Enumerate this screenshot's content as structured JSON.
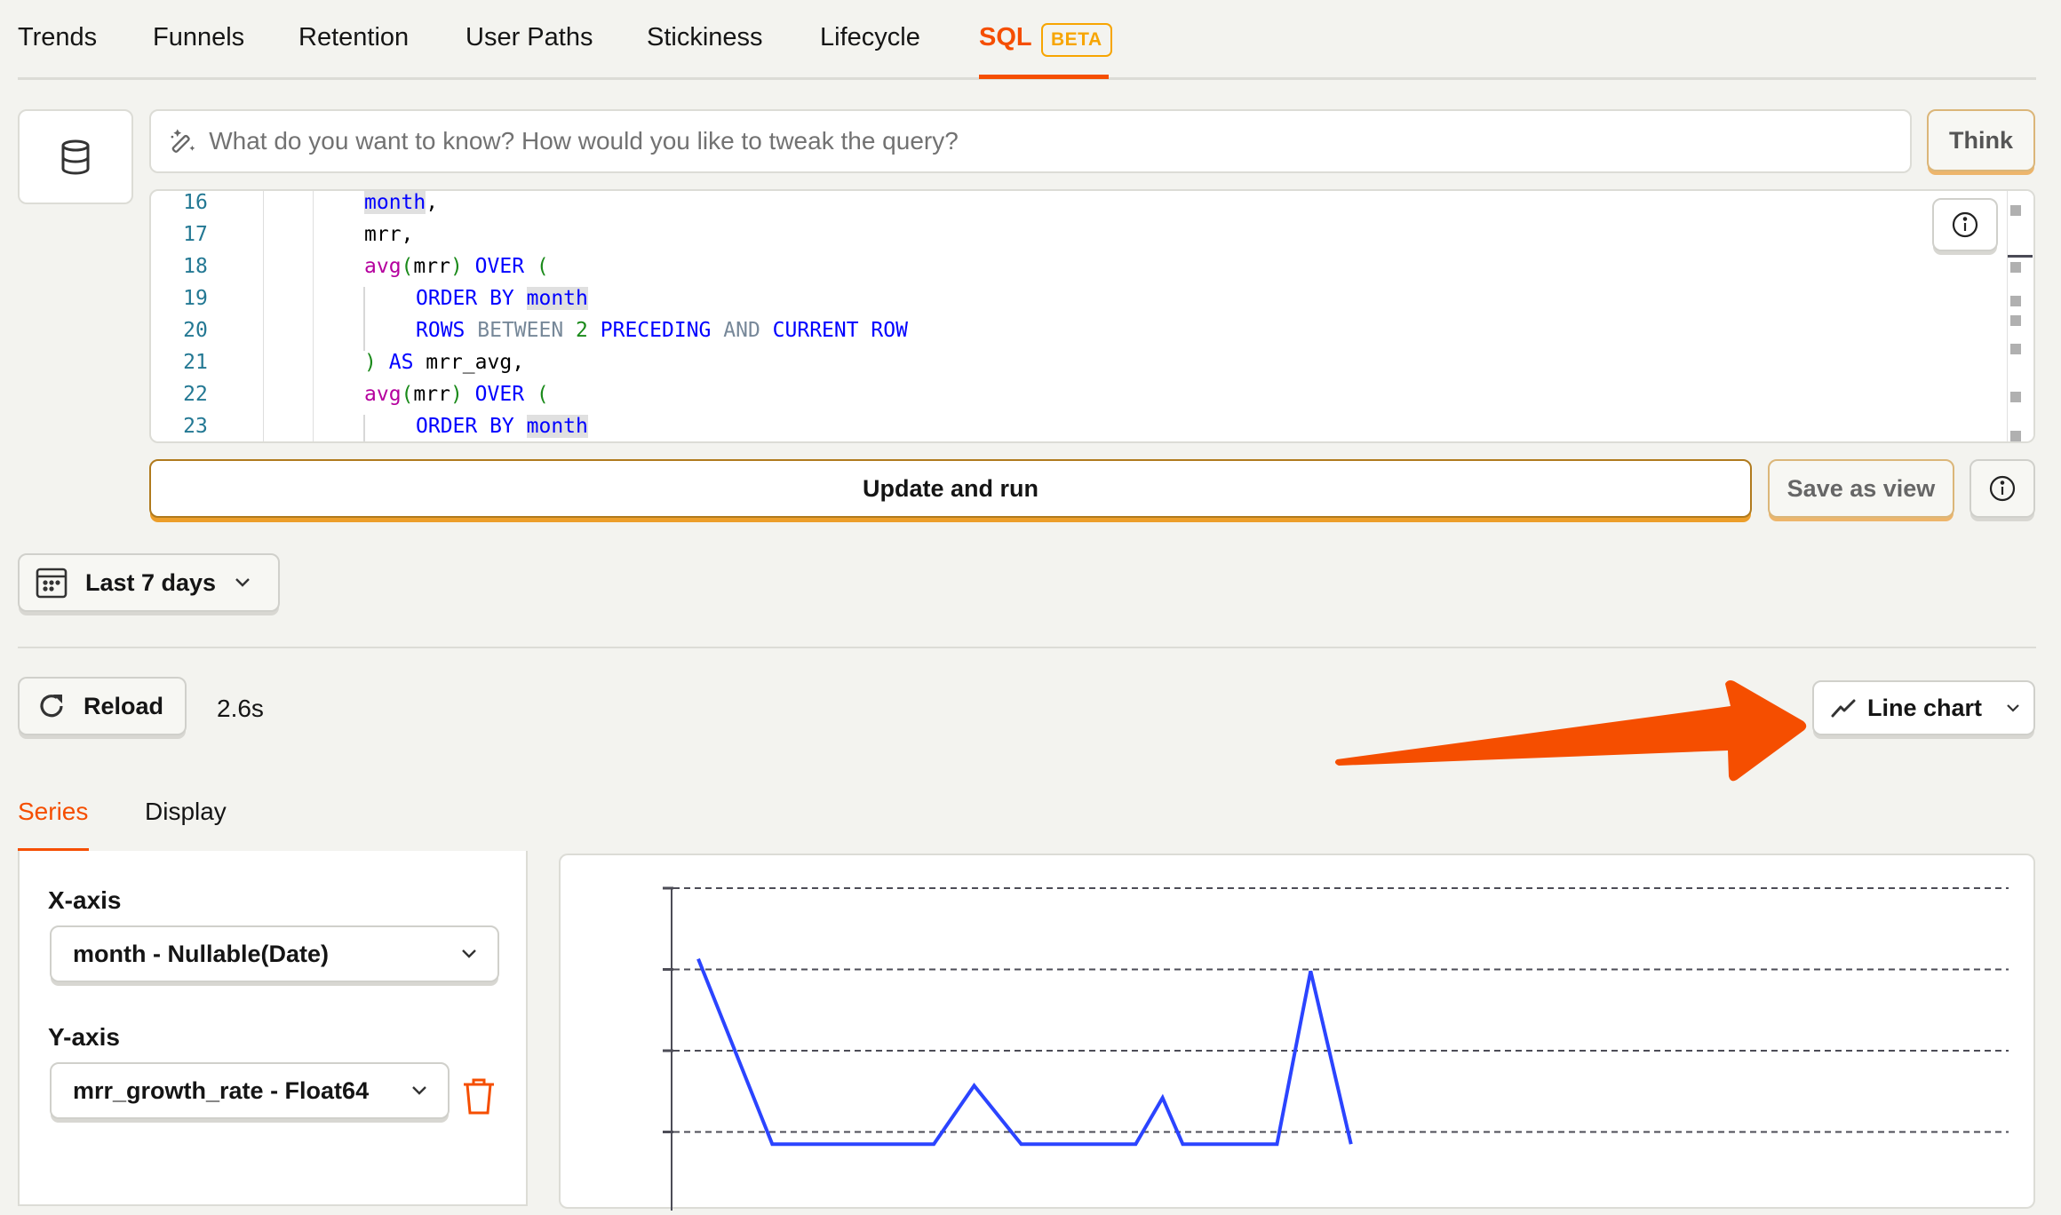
{
  "nav": {
    "tabs": [
      {
        "label": "Trends",
        "active": false
      },
      {
        "label": "Funnels",
        "active": false
      },
      {
        "label": "Retention",
        "active": false
      },
      {
        "label": "User Paths",
        "active": false
      },
      {
        "label": "Stickiness",
        "active": false
      },
      {
        "label": "Lifecycle",
        "active": false
      },
      {
        "label": "SQL",
        "active": true
      }
    ],
    "beta_badge": "BETA"
  },
  "query": {
    "prompt_placeholder": "What do you want to know? How would you like to tweak the query?",
    "think_label": "Think",
    "code_lines": [
      {
        "n": "16",
        "text": "month,"
      },
      {
        "n": "17",
        "text": "mrr,"
      },
      {
        "n": "18",
        "text": "avg(mrr) OVER ("
      },
      {
        "n": "19",
        "text": "ORDER BY month"
      },
      {
        "n": "20",
        "text": "ROWS BETWEEN 2 PRECEDING AND CURRENT ROW"
      },
      {
        "n": "21",
        "text": ") AS mrr_avg,"
      },
      {
        "n": "22",
        "text": "avg(mrr) OVER ("
      },
      {
        "n": "23",
        "text": "ORDER BY month"
      }
    ],
    "update_run_label": "Update and run",
    "save_view_label": "Save as view"
  },
  "filters": {
    "date_range": "Last 7 days"
  },
  "results": {
    "reload_label": "Reload",
    "duration": "2.6s",
    "chart_type": "Line chart",
    "subtabs": [
      {
        "label": "Series",
        "active": true
      },
      {
        "label": "Display",
        "active": false
      }
    ],
    "x_axis_label": "X-axis",
    "x_axis_value": "month - Nullable(Date)",
    "y_axis_label": "Y-axis",
    "y_axis_value": "mrr_growth_rate - Float64"
  },
  "colors": {
    "accent": "#f54e00",
    "beta": "#f7a501",
    "series": "#2b44ff"
  },
  "chart_data": {
    "type": "line",
    "title": "",
    "xlabel": "",
    "ylabel": "",
    "grid": true,
    "gridlines_visible": 4,
    "ylim_visible_fraction": [
      0,
      1
    ],
    "series": [
      {
        "name": "mrr_growth_rate",
        "note": "values as fraction of visible plot height (0 = bottom of visible area, 1 = top gridline); chart is cut off at the bottom",
        "points": [
          {
            "x": 0.0,
            "y": 0.71
          },
          {
            "x": 0.055,
            "y": -0.05
          },
          {
            "x": 0.175,
            "y": -0.05
          },
          {
            "x": 0.205,
            "y": 0.19
          },
          {
            "x": 0.24,
            "y": -0.05
          },
          {
            "x": 0.325,
            "y": -0.05
          },
          {
            "x": 0.345,
            "y": 0.14
          },
          {
            "x": 0.36,
            "y": -0.05
          },
          {
            "x": 0.43,
            "y": -0.05
          },
          {
            "x": 0.455,
            "y": 0.66
          },
          {
            "x": 0.485,
            "y": -0.05
          }
        ]
      }
    ]
  }
}
